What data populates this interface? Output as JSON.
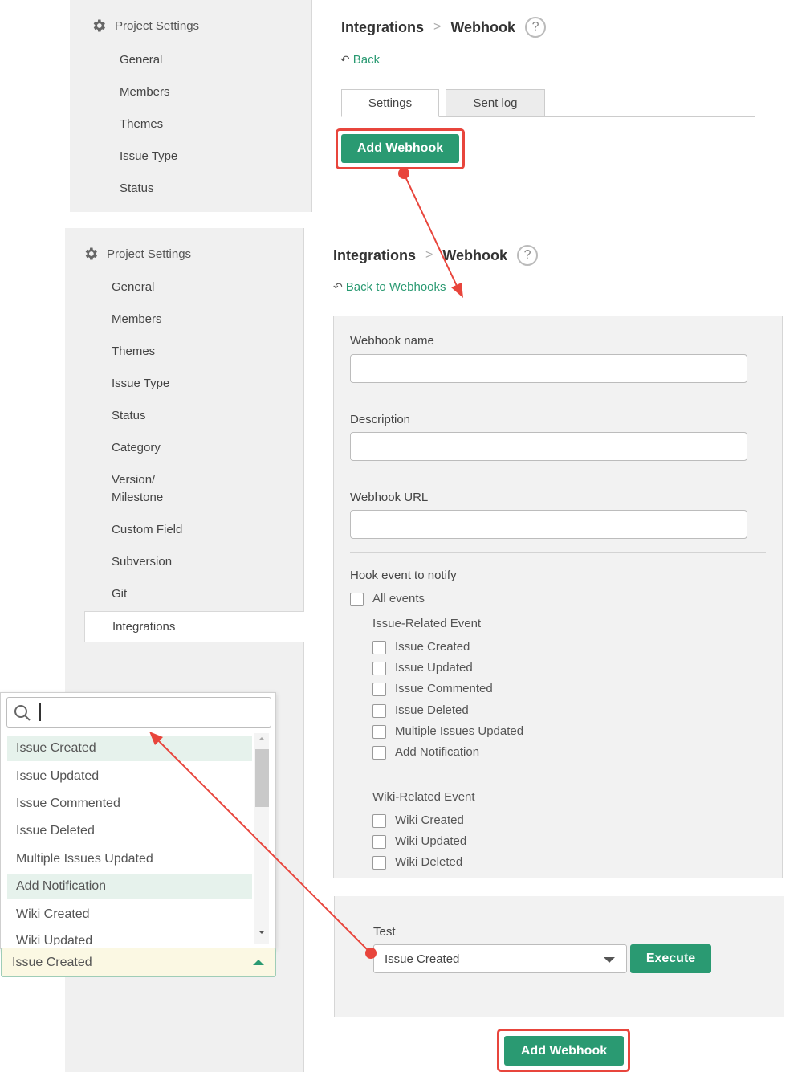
{
  "top_view": {
    "sidebar": {
      "header": "Project Settings",
      "items": [
        "General",
        "Members",
        "Themes",
        "Issue Type",
        "Status"
      ]
    },
    "breadcrumb": {
      "parent": "Integrations",
      "separator": ">",
      "current": "Webhook",
      "help": "?"
    },
    "back_label": "Back",
    "tabs": [
      "Settings",
      "Sent log"
    ],
    "add_webhook_label": "Add Webhook"
  },
  "bottom_view": {
    "sidebar": {
      "header": "Project Settings",
      "items": [
        "General",
        "Members",
        "Themes",
        "Issue Type",
        "Status",
        "Category",
        "Version/",
        "Milestone",
        "Custom Field",
        "Subversion",
        "Git",
        "Integrations"
      ]
    },
    "breadcrumb": {
      "parent": "Integrations",
      "separator": ">",
      "current": "Webhook",
      "help": "?"
    },
    "back_label": "Back to Webhooks",
    "form": {
      "webhook_name_label": "Webhook name",
      "description_label": "Description",
      "webhook_url_label": "Webhook URL",
      "hook_event_label": "Hook event to notify",
      "all_events_label": "All events",
      "issue_group_label": "Issue-Related Event",
      "issue_events": [
        "Issue Created",
        "Issue Updated",
        "Issue Commented",
        "Issue Deleted",
        "Multiple Issues Updated",
        "Add Notification"
      ],
      "wiki_group_label": "Wiki-Related Event",
      "wiki_events": [
        "Wiki Created",
        "Wiki Updated",
        "Wiki Deleted"
      ],
      "test_label": "Test",
      "test_selected": "Issue Created",
      "execute_label": "Execute"
    },
    "add_webhook_label": "Add Webhook"
  },
  "dropdown_popup": {
    "options": [
      "Issue Created",
      "Issue Updated",
      "Issue Commented",
      "Issue Deleted",
      "Multiple Issues Updated",
      "Add Notification",
      "Wiki Created",
      "Wiki Updated"
    ],
    "selected": "Issue Created"
  },
  "colors": {
    "accent": "#2a9a72",
    "annotation": "#e8453c",
    "sidebar_bg": "#f0f0f0"
  }
}
